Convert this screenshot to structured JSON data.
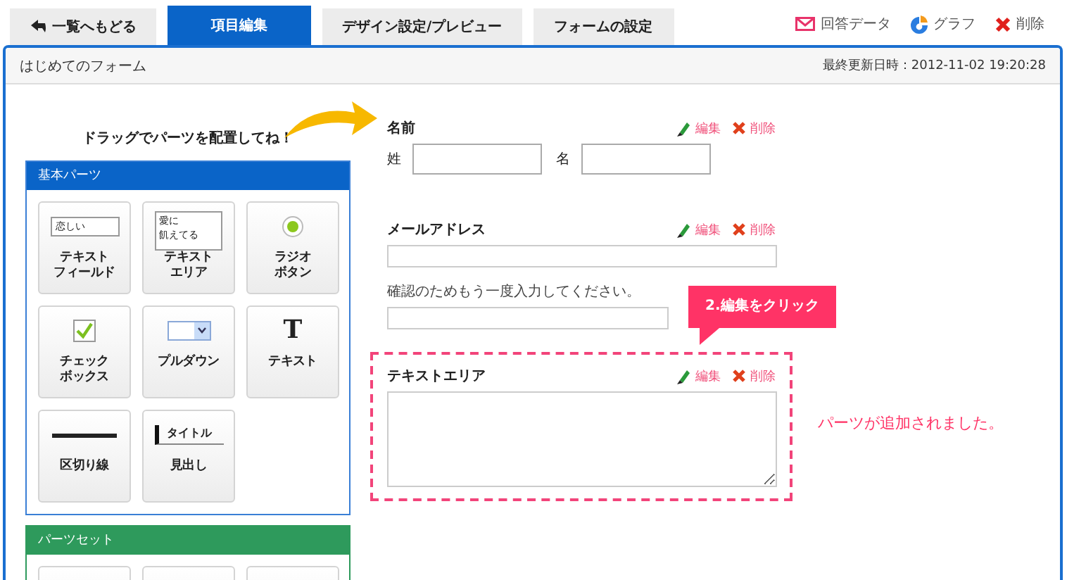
{
  "tabs": [
    {
      "label": "一覧へもどる",
      "kind": "back",
      "selected": false
    },
    {
      "label": "項目編集",
      "kind": "tab",
      "selected": true
    },
    {
      "label": "デザイン設定/プレビュー",
      "kind": "tab",
      "selected": false
    },
    {
      "label": "フォームの設定",
      "kind": "tab",
      "selected": false
    }
  ],
  "actions": [
    {
      "label": "回答データ",
      "kind": "mail"
    },
    {
      "label": "グラフ",
      "kind": "graph"
    },
    {
      "label": "削除",
      "kind": "delete"
    }
  ],
  "form_title": "はじめてのフォーム",
  "last_updated": "最終更新日時：2012-11-02 19:20:28",
  "palette": {
    "hint": "ドラッグでパーツを配置してね！",
    "basic": {
      "title": "基本パーツ",
      "items": [
        {
          "kind": "textfield",
          "label": [
            "テキスト",
            "フィールド"
          ],
          "preview_text": [
            "恋しい"
          ]
        },
        {
          "kind": "textarea",
          "label": [
            "テキスト",
            "エリア"
          ],
          "preview_text": [
            "愛に",
            "飢えてる"
          ]
        },
        {
          "kind": "radio",
          "label": [
            "ラジオ",
            "ボタン"
          ]
        },
        {
          "kind": "checkbox",
          "label": [
            "チェック",
            "ボックス"
          ]
        },
        {
          "kind": "pulldown",
          "label": [
            "プルダウン"
          ]
        },
        {
          "kind": "text",
          "label": [
            "テキスト"
          ],
          "preview_text": [
            "T"
          ]
        },
        {
          "kind": "divider",
          "label": [
            "区切り線"
          ]
        },
        {
          "kind": "heading",
          "label": [
            "見出し"
          ],
          "preview_text": [
            "タイトル"
          ]
        }
      ]
    },
    "sets": {
      "title": "パーツセット"
    }
  },
  "fields": [
    {
      "kind": "name",
      "label": "名前",
      "sublabels": [
        "姓",
        "名"
      ],
      "edit": "編集",
      "delete": "削除",
      "highlighted": false
    },
    {
      "kind": "email",
      "label": "メールアドレス",
      "confirm_label": "確認のためもう一度入力してください。",
      "edit": "編集",
      "delete": "削除",
      "highlighted": false
    },
    {
      "kind": "textarea",
      "label": "テキストエリア",
      "edit": "編集",
      "delete": "削除",
      "highlighted": true
    }
  ],
  "callout": "2.編集をクリック",
  "notice": "パーツが追加されました。"
}
